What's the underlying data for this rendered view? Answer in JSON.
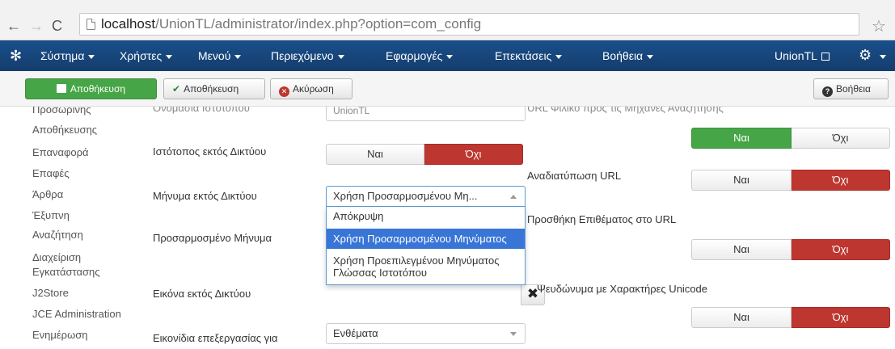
{
  "browser": {
    "url_host": "localhost",
    "url_path": "/UnionTL/administrator/index.php?option=com_config"
  },
  "navbar": {
    "menu": [
      "Σύστημα",
      "Χρήστες",
      "Μενού",
      "Περιεχόμενο",
      "Εφαρμογές",
      "Επεκτάσεις",
      "Βοήθεια"
    ],
    "site_link": "UnionTL"
  },
  "toolbar": {
    "save_close": "Αποθήκευση",
    "save": "Αποθήκευση",
    "cancel": "Ακύρωση",
    "help": "Βοήθεια"
  },
  "sidebar": {
    "items": [
      "Προσωρινής",
      "Αποθήκευσης",
      "Επαναφορά",
      "Επαφές",
      "Άρθρα",
      "Έξυπνη",
      "Αναζήτηση",
      "Διαχείριση",
      "Εγκατάστασης",
      "J2Store",
      "JCE Administration",
      "Ενημέρωση"
    ]
  },
  "form": {
    "site_name_label": "Ονομασία Ιστότοπου",
    "site_name_value": "UnionTL",
    "offline_label": "Ιστότοπος εκτός Δικτύου",
    "offline_yes": "Ναι",
    "offline_no": "Όχι",
    "offline_message_label": "Μήνυμα εκτός Δικτύου",
    "offline_message_value": "Χρήση Προσαρμοσμένου Μη...",
    "offline_message_options": [
      "Απόκρυψη",
      "Χρήση Προσαρμοσμένου Μηνύματος",
      "Χρήση Προεπιλεγμένου Μηνύματος Γλώσσας Ιστοτόπου"
    ],
    "custom_message_label": "Προσαρμοσμένο Μήνυμα",
    "offline_image_label": "Εικόνα εκτός Δικτύου",
    "edit_icons_label": "Εικονίδια επεξεργασίας για",
    "edit_icons_value": "Ενθέματα"
  },
  "seo": {
    "sef_label": "URL Φιλικό προς τις Μηχανές Αναζήτησης",
    "sef_yes": "Ναι",
    "sef_no": "Όχι",
    "rewrite_label": "Αναδιατύπωση URL",
    "rewrite_yes": "Ναι",
    "rewrite_no": "Όχι",
    "suffix_label": "Προσθήκη Επιθέματος στο URL",
    "suffix_yes": "Ναι",
    "suffix_no": "Όχι",
    "unicode_label": "Ψευδώνυμα με Χαρακτήρες Unicode",
    "unicode_yes": "Ναι",
    "unicode_no": "Όχι"
  }
}
